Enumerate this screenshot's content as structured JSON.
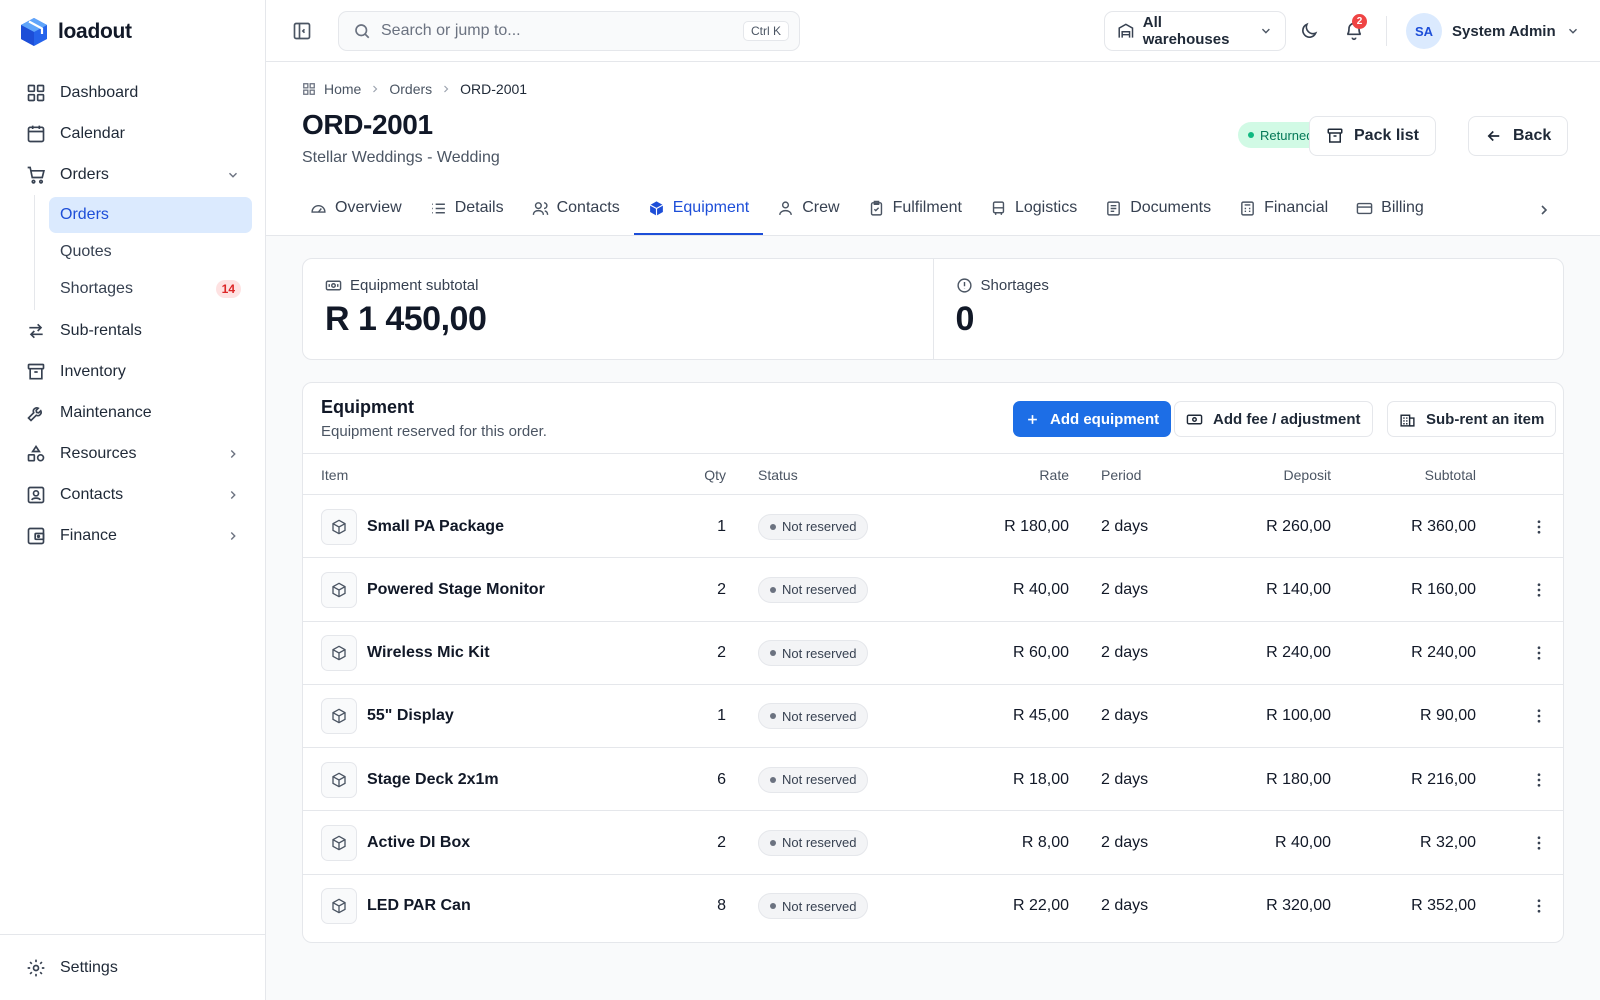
{
  "app": {
    "name": "loadout"
  },
  "sidebar": {
    "items": [
      {
        "label": "Dashboard",
        "icon": "grid-icon"
      },
      {
        "label": "Calendar",
        "icon": "calendar-icon"
      },
      {
        "label": "Orders",
        "icon": "cart-icon",
        "expanded": true
      },
      {
        "label": "Sub-rentals",
        "icon": "arrows-icon"
      },
      {
        "label": "Inventory",
        "icon": "archive-icon"
      },
      {
        "label": "Maintenance",
        "icon": "wrench-icon"
      },
      {
        "label": "Resources",
        "icon": "shapes-icon"
      },
      {
        "label": "Contacts",
        "icon": "contact-card-icon"
      },
      {
        "label": "Finance",
        "icon": "wallet-icon"
      }
    ],
    "orders_sub": [
      {
        "label": "Orders",
        "active": true
      },
      {
        "label": "Quotes"
      },
      {
        "label": "Shortages",
        "count": "14"
      }
    ],
    "footer": {
      "label": "Settings"
    }
  },
  "topbar": {
    "search_placeholder": "Search or jump to...",
    "shortcut": "Ctrl K",
    "warehouse": "All warehouses",
    "notifications_count": "2",
    "user_initials": "SA",
    "user_name": "System Admin"
  },
  "breadcrumb": [
    "Home",
    "Orders",
    "ORD-2001"
  ],
  "page": {
    "title": "ORD-2001",
    "subtitle": "Stellar Weddings - Wedding",
    "status": "Returned",
    "pack_list_label": "Pack list",
    "back_label": "Back"
  },
  "tabs": [
    "Overview",
    "Details",
    "Contacts",
    "Equipment",
    "Crew",
    "Fulfilment",
    "Logistics",
    "Documents",
    "Financial",
    "Billing"
  ],
  "active_tab": "Equipment",
  "stats": {
    "subtotal_label": "Equipment subtotal",
    "subtotal_value": "R 1 450,00",
    "shortages_label": "Shortages",
    "shortages_value": "0"
  },
  "equipment": {
    "title": "Equipment",
    "subtitle": "Equipment reserved for this order.",
    "add_label": "Add equipment",
    "fee_label": "Add fee / adjustment",
    "subrent_label": "Sub-rent an item",
    "columns": [
      "Item",
      "Qty",
      "Status",
      "Rate",
      "Period",
      "Deposit",
      "Subtotal"
    ],
    "rows": [
      {
        "name": "Small PA Package",
        "qty": "1",
        "status": "Not reserved",
        "rate": "R 180,00",
        "period": "2 days",
        "deposit": "R 260,00",
        "subtotal": "R 360,00"
      },
      {
        "name": "Powered Stage Monitor",
        "qty": "2",
        "status": "Not reserved",
        "rate": "R 40,00",
        "period": "2 days",
        "deposit": "R 140,00",
        "subtotal": "R 160,00"
      },
      {
        "name": "Wireless Mic Kit",
        "qty": "2",
        "status": "Not reserved",
        "rate": "R 60,00",
        "period": "2 days",
        "deposit": "R 240,00",
        "subtotal": "R 240,00"
      },
      {
        "name": "55\" Display",
        "qty": "1",
        "status": "Not reserved",
        "rate": "R 45,00",
        "period": "2 days",
        "deposit": "R 100,00",
        "subtotal": "R 90,00"
      },
      {
        "name": "Stage Deck 2x1m",
        "qty": "6",
        "status": "Not reserved",
        "rate": "R 18,00",
        "period": "2 days",
        "deposit": "R 180,00",
        "subtotal": "R 216,00"
      },
      {
        "name": "Active DI Box",
        "qty": "2",
        "status": "Not reserved",
        "rate": "R 8,00",
        "period": "2 days",
        "deposit": "R 40,00",
        "subtotal": "R 32,00"
      },
      {
        "name": "LED PAR Can",
        "qty": "8",
        "status": "Not reserved",
        "rate": "R 22,00",
        "period": "2 days",
        "deposit": "R 320,00",
        "subtotal": "R 352,00"
      }
    ]
  },
  "colors": {
    "accent": "#1d6ee6",
    "active_bg": "#dbeafe",
    "success": "#10b981",
    "danger": "#ef4444"
  }
}
